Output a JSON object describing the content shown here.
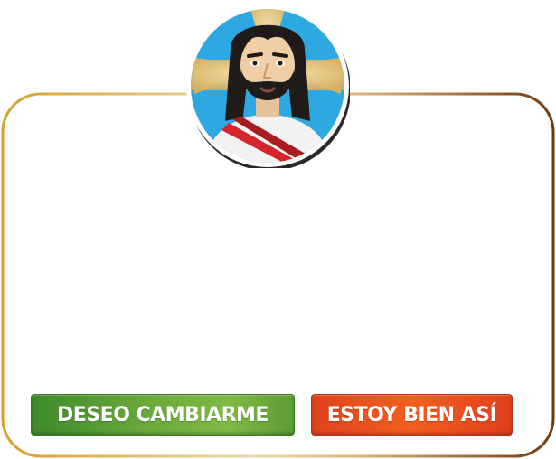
{
  "dialog": {
    "avatar_icon": "jesus-portrait-icon",
    "frame_colors": {
      "left": "#d4a12a",
      "center": "#e8d7a8",
      "right": "#6e3a12"
    }
  },
  "buttons": {
    "change_label": "DESEO CAMBIARME",
    "change_color": "#5c9c36",
    "fine_label": "ESTOY BIEN ASÍ",
    "fine_color": "#e8491d"
  }
}
